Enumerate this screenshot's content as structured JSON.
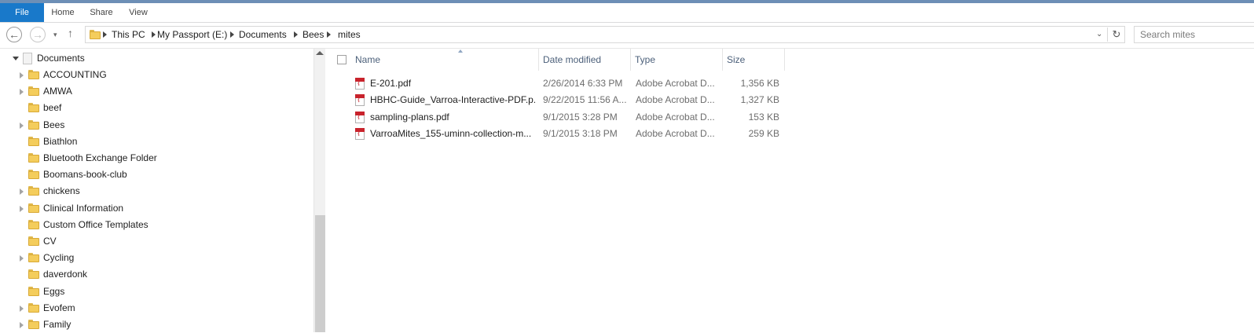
{
  "ribbon": {
    "tabs": [
      "File",
      "Home",
      "Share",
      "View"
    ]
  },
  "address": {
    "crumbs": [
      "This PC",
      "My Passport (E:)",
      "Documents",
      "Bees",
      "mites"
    ],
    "search_placeholder": "Search mites"
  },
  "navpane": {
    "root": "Documents",
    "items": [
      {
        "label": "ACCOUNTING",
        "expandable": true
      },
      {
        "label": "AMWA",
        "expandable": true
      },
      {
        "label": "beef",
        "expandable": false
      },
      {
        "label": "Bees",
        "expandable": true
      },
      {
        "label": "Biathlon",
        "expandable": false
      },
      {
        "label": "Bluetooth Exchange Folder",
        "expandable": false
      },
      {
        "label": "Boomans-book-club",
        "expandable": false
      },
      {
        "label": "chickens",
        "expandable": true
      },
      {
        "label": "Clinical Information",
        "expandable": true
      },
      {
        "label": "Custom Office Templates",
        "expandable": false
      },
      {
        "label": "CV",
        "expandable": false
      },
      {
        "label": "Cycling",
        "expandable": true
      },
      {
        "label": "daverdonk",
        "expandable": false
      },
      {
        "label": "Eggs",
        "expandable": false
      },
      {
        "label": "Evofem",
        "expandable": true
      },
      {
        "label": "Family",
        "expandable": true
      }
    ]
  },
  "filelist": {
    "columns": [
      "Name",
      "Date modified",
      "Type",
      "Size"
    ],
    "files": [
      {
        "name": "E-201.pdf",
        "date": "2/26/2014 6:33 PM",
        "type": "Adobe Acrobat D...",
        "size": "1,356 KB"
      },
      {
        "name": "HBHC-Guide_Varroa-Interactive-PDF.p...",
        "date": "9/22/2015 11:56 A...",
        "type": "Adobe Acrobat D...",
        "size": "1,327 KB"
      },
      {
        "name": "sampling-plans.pdf",
        "date": "9/1/2015 3:28 PM",
        "type": "Adobe Acrobat D...",
        "size": "153 KB"
      },
      {
        "name": "VarroaMites_155-uminn-collection-m...",
        "date": "9/1/2015 3:18 PM",
        "type": "Adobe Acrobat D...",
        "size": "259 KB"
      }
    ]
  },
  "colors": {
    "file_tab": "#1979ca",
    "header_text": "#4c607a",
    "folder": "#f4cd5c",
    "pdf_red": "#c8232c"
  }
}
